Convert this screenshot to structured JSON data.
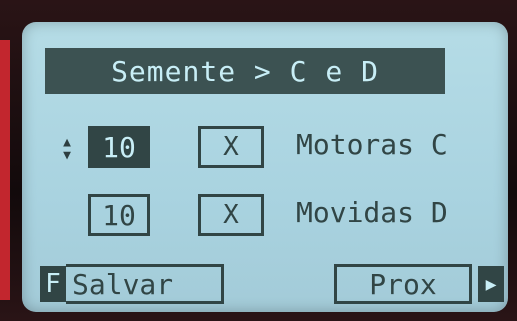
{
  "screen": {
    "title": "Semente > C e D",
    "rows": [
      {
        "value": "10",
        "check": "X",
        "label": "Motoras C",
        "selected": true
      },
      {
        "value": "10",
        "check": "X",
        "label": "Movidas D",
        "selected": false
      }
    ],
    "updown_icon": "up-down-arrows",
    "footer": {
      "f_key": "F",
      "save_label": "Salvar",
      "next_label": "Prox",
      "next_arrow_icon": "arrow-right"
    }
  },
  "colors": {
    "lcd_background": "#a9d3e0",
    "lcd_dark": "#314545",
    "lcd_light_text": "#c8eef6",
    "bezel": "#1b0e10",
    "accent_red": "#c2262e"
  }
}
